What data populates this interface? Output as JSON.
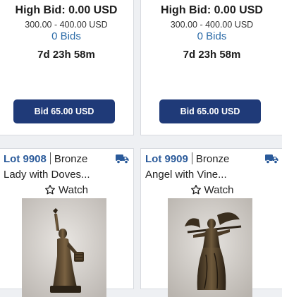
{
  "lots_top": [
    {
      "high_bid": "High Bid: 0.00 USD",
      "estimate": "300.00 - 400.00 USD",
      "bids": "0 Bids",
      "time_left": "7d 23h 58m",
      "bid_button": "Bid 65.00 USD"
    },
    {
      "high_bid": "High Bid: 0.00 USD",
      "estimate": "300.00 - 400.00 USD",
      "bids": "0 Bids",
      "time_left": "7d 23h 58m",
      "bid_button": "Bid 65.00 USD"
    }
  ],
  "lots_bottom": [
    {
      "lot": "Lot 9908",
      "category": "Bronze",
      "title": "Lady with Doves...",
      "watch": "Watch",
      "shipping_icon": "truck-icon",
      "image": "bronze-lady-statue"
    },
    {
      "lot": "Lot 9909",
      "category": "Bronze",
      "title": "Angel with Vine...",
      "watch": "Watch",
      "shipping_icon": "truck-icon",
      "image": "bronze-angel-statue"
    }
  ],
  "colors": {
    "accent_blue": "#2a5a9a",
    "button_navy": "#1f3a78",
    "bids_link": "#2d6ca8"
  }
}
